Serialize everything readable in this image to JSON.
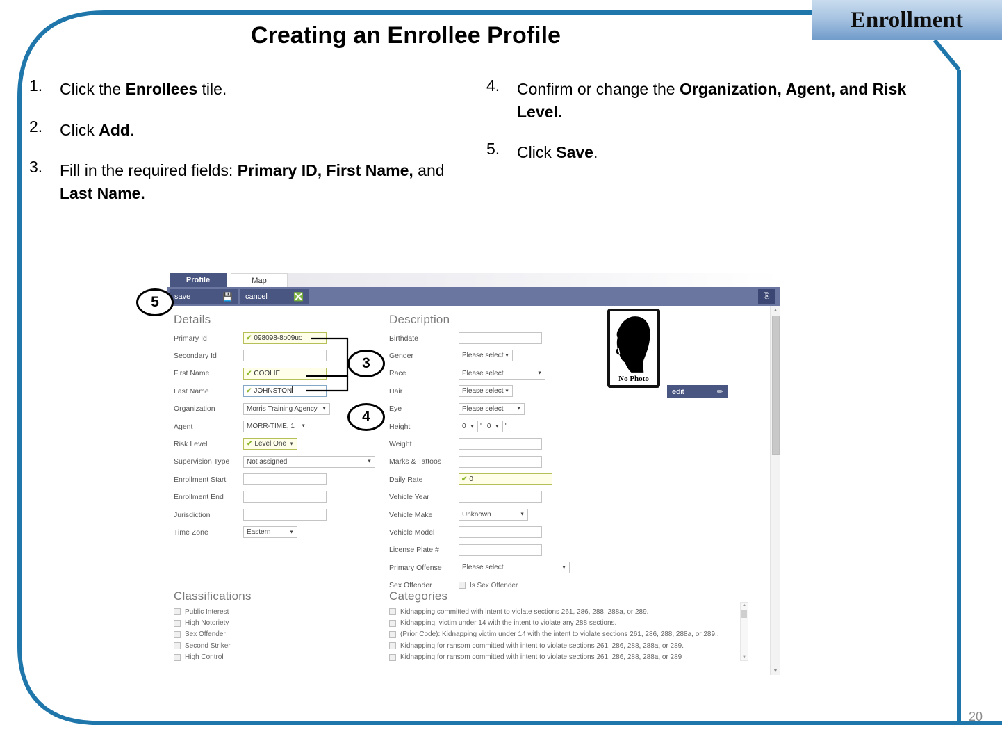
{
  "section_tab": {
    "label": "Enrollment"
  },
  "slide": {
    "title": "Creating an Enrollee Profile",
    "page_number": "20"
  },
  "steps_left": [
    {
      "num": "1.",
      "html": "Click the <b>Enrollees</b> tile."
    },
    {
      "num": "2.",
      "html": "Click <b>Add</b>."
    },
    {
      "num": "3.",
      "html": "Fill in the required fields: <b>Primary ID, First Name,</b> and <b>Last Name.</b>"
    }
  ],
  "steps_right": [
    {
      "num": "4.",
      "html": "Confirm or change the <b>Organization, Agent, and Risk Level.</b>"
    },
    {
      "num": "5.",
      "html": "Click <b>Save</b>."
    }
  ],
  "callouts": [
    {
      "label": "5"
    },
    {
      "label": "3"
    },
    {
      "label": "4"
    }
  ],
  "app": {
    "tabs": [
      {
        "label": "Profile",
        "selected": true
      },
      {
        "label": "Map",
        "selected": false
      }
    ],
    "toolbar": {
      "save_label": "save",
      "save_icon": "floppy-disk-icon",
      "cancel_label": "cancel",
      "cancel_icon": "circle-x-icon",
      "report_icon": "report-icon",
      "report_glyph": "⎘"
    },
    "details": {
      "heading": "Details",
      "fields": [
        {
          "label": "Primary Id",
          "type": "text",
          "value": "098098-8o09uo",
          "valid": true,
          "width": "w120"
        },
        {
          "label": "Secondary Id",
          "type": "text",
          "value": "",
          "valid": false,
          "width": "w120"
        },
        {
          "label": "First Name",
          "type": "text",
          "value": "COOLIE",
          "valid": true,
          "width": "w120"
        },
        {
          "label": "Last Name",
          "type": "text",
          "value": "JOHNSTON",
          "valid": true,
          "width": "w120",
          "focused": true
        },
        {
          "label": "Organization",
          "type": "select",
          "value": "Morris Training Agency",
          "valid": false,
          "width": "w125"
        },
        {
          "label": "Agent",
          "type": "select",
          "value": "MORR-TIME, 1",
          "valid": false,
          "width": "w95"
        },
        {
          "label": "Risk Level",
          "type": "select",
          "value": "Level One",
          "valid": true,
          "width": "w78"
        },
        {
          "label": "Supervision Type",
          "type": "select",
          "value": "Not assigned",
          "valid": false,
          "width": "w190"
        },
        {
          "label": "Enrollment Start",
          "type": "text",
          "value": "",
          "valid": false,
          "width": "w120"
        },
        {
          "label": "Enrollment End",
          "type": "text",
          "value": "",
          "valid": false,
          "width": "w120"
        },
        {
          "label": "Jurisdiction",
          "type": "text",
          "value": "",
          "valid": false,
          "width": "w120"
        },
        {
          "label": "Time Zone",
          "type": "select",
          "value": "Eastern",
          "valid": false,
          "width": "w78"
        }
      ]
    },
    "description": {
      "heading": "Description",
      "fields": [
        {
          "label": "Birthdate",
          "type": "text",
          "value": "",
          "valid": false,
          "width": "w120"
        },
        {
          "label": "Gender",
          "type": "select",
          "value": "Please select",
          "valid": false,
          "width": "w78"
        },
        {
          "label": "Race",
          "type": "select",
          "value": "Please select",
          "valid": false,
          "width": "w125"
        },
        {
          "label": "Hair",
          "type": "select",
          "value": "Please select",
          "valid": false,
          "width": "w78"
        },
        {
          "label": "Eye",
          "type": "select",
          "value": "Please select",
          "valid": false,
          "width": "w95"
        },
        {
          "label": "Height",
          "type": "height",
          "feet": "0",
          "inches": "0",
          "feet_mark": "'",
          "inch_mark": "\""
        },
        {
          "label": "Weight",
          "type": "text",
          "value": "",
          "valid": false,
          "width": "w120"
        },
        {
          "label": "Marks & Tattoos",
          "type": "text",
          "value": "",
          "valid": false,
          "width": "w120"
        },
        {
          "label": "Daily Rate",
          "type": "text",
          "value": "0",
          "valid": true,
          "width": "w135"
        },
        {
          "label": "Vehicle Year",
          "type": "text",
          "value": "",
          "valid": false,
          "width": "w120"
        },
        {
          "label": "Vehicle Make",
          "type": "select",
          "value": "Unknown",
          "valid": false,
          "width": "w100"
        },
        {
          "label": "Vehicle Model",
          "type": "text",
          "value": "",
          "valid": false,
          "width": "w120"
        },
        {
          "label": "License Plate #",
          "type": "text",
          "value": "",
          "valid": false,
          "width": "w120"
        },
        {
          "label": "Primary Offense",
          "type": "select",
          "value": "Please select",
          "valid": false,
          "width": "w160"
        },
        {
          "label": "Sex Offender",
          "type": "checkbox",
          "value": "Is Sex Offender",
          "checked": false
        }
      ]
    },
    "photo": {
      "caption": "No Photo",
      "edit_label": "edit",
      "edit_icon": "pencil-icon"
    },
    "classifications": {
      "heading": "Classifications",
      "items": [
        {
          "label": "Public Interest",
          "checked": false
        },
        {
          "label": "High Notoriety",
          "checked": false
        },
        {
          "label": "Sex Offender",
          "checked": false
        },
        {
          "label": "Second Striker",
          "checked": false
        },
        {
          "label": "High Control",
          "checked": false
        }
      ]
    },
    "categories": {
      "heading": "Categories",
      "items": [
        {
          "label": "Kidnapping committed with intent to violate sections 261, 286, 288, 288a, or 289.",
          "checked": false
        },
        {
          "label": "Kidnapping, victim under 14 with the intent to violate any 288 sections.",
          "checked": false
        },
        {
          "label": "(Prior Code): Kidnapping victim under 14 with the intent to violate sections 261, 286, 288, 288a, or 289..",
          "checked": false
        },
        {
          "label": "Kidnapping for ransom committed with intent to violate sections 261, 286, 288, 288a, or 289.",
          "checked": false
        },
        {
          "label": "Kidnapping for ransom committed with intent to violate sections 261, 286, 288, 288a, or 289",
          "checked": false
        }
      ]
    }
  },
  "colors": {
    "frame_blue": "#1f76ab",
    "toolbar_blue": "#6b76a0",
    "button_blue": "#4a5682",
    "valid_green": "#8cb82b",
    "valid_bg": "#fefee9"
  }
}
